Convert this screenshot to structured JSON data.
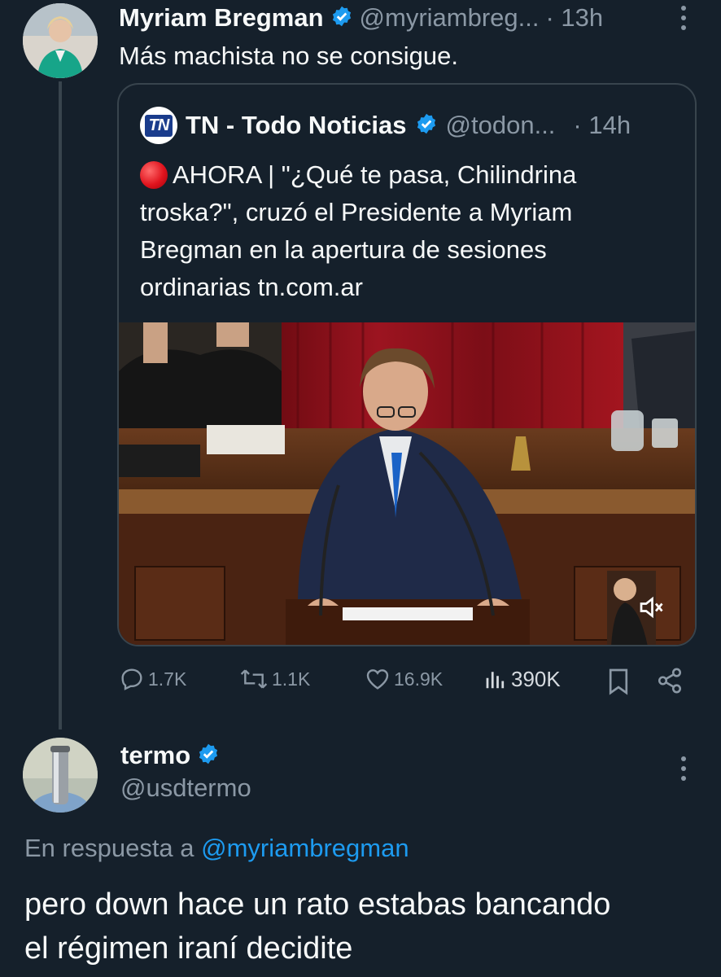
{
  "tweet": {
    "author_name": "Myriam Bregman",
    "author_handle": "@myriambreg...",
    "time": "· 13h",
    "text": "Más machista no se consigue.",
    "quote": {
      "logo_text": "TN",
      "author_name": "TN - Todo Noticias",
      "author_handle": "@todon...",
      "time": "· 14h",
      "text_line1": "AHORA | \"¿Qué te pasa, Chilindrina",
      "text_line2": "troska?\", cruzó el Presidente a Myriam",
      "text_line3": "Bregman en la apertura de sesiones",
      "text_line4": "ordinarias tn.com.ar"
    },
    "stats": {
      "replies": "1.7K",
      "retweets": "1.1K",
      "likes": "16.9K",
      "views": "390K"
    }
  },
  "reply": {
    "author_name": "termo",
    "author_handle": "@usdtermo",
    "reply_prefix": "En respuesta a ",
    "reply_mention": "@myriambregman",
    "text_line1": "pero down hace un rato estabas bancando",
    "text_line2": "el régimen iraní decidite"
  },
  "colors": {
    "background": "#15202b",
    "verified": "#1d9bf0",
    "muted": "#8b98a5",
    "border": "#38444d",
    "live_dot": "#e0141e"
  },
  "icons": [
    "verified-icon",
    "more-icon",
    "reply-icon",
    "retweet-icon",
    "like-icon",
    "views-icon",
    "bookmark-icon",
    "share-icon",
    "mute-icon",
    "live-dot-icon"
  ]
}
